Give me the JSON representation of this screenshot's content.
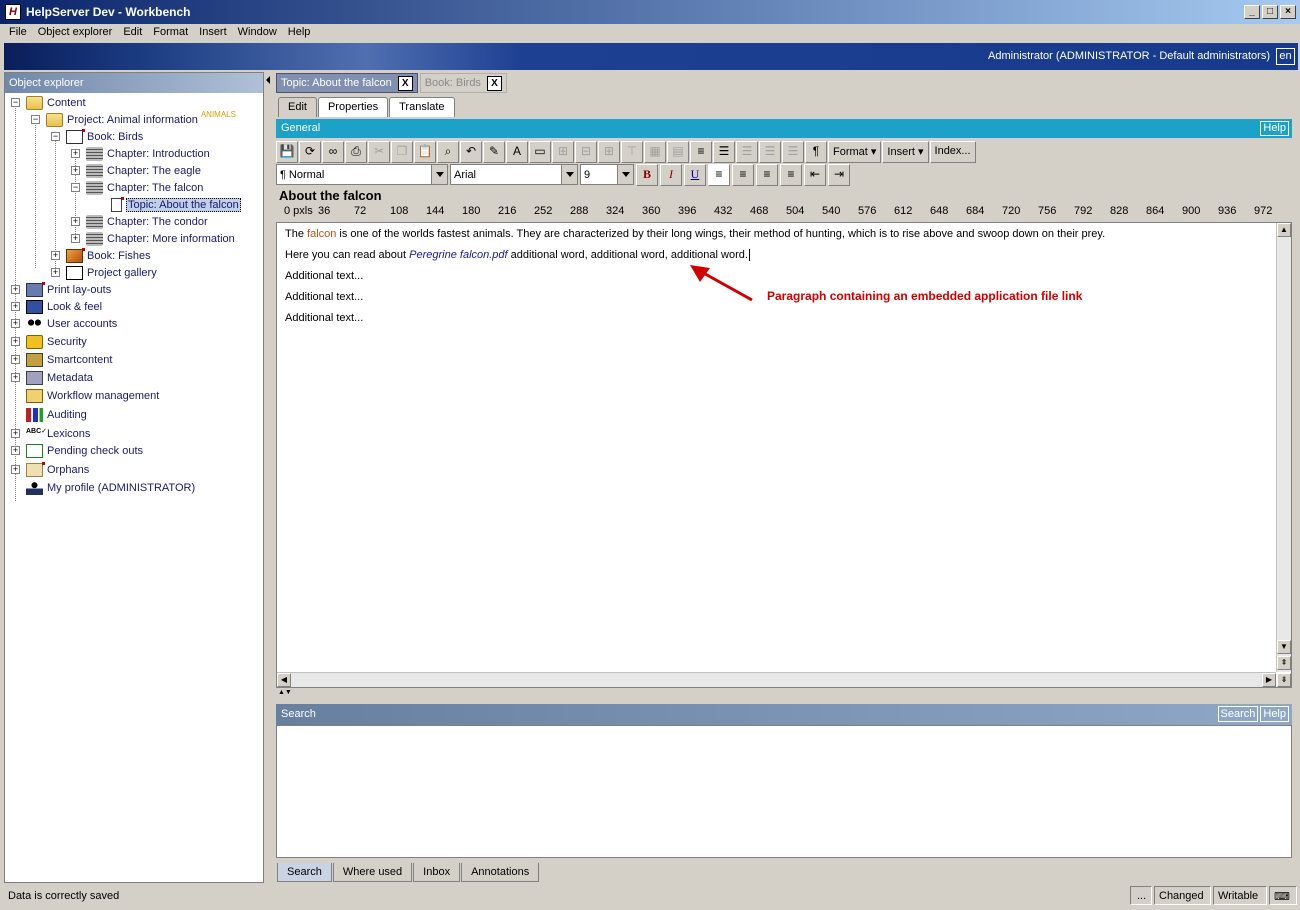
{
  "window": {
    "title": "HelpServer Dev - Workbench",
    "app_icon": "H"
  },
  "menu": [
    "File",
    "Object explorer",
    "Edit",
    "Format",
    "Insert",
    "Window",
    "Help"
  ],
  "banner": {
    "user": "Administrator (ADMINISTRATOR - Default administrators)",
    "lang": "en"
  },
  "explorer": {
    "header": "Object explorer",
    "items": [
      {
        "label": "Content",
        "icon": "folder-icon"
      },
      {
        "label": "Project: Animal information",
        "tag": "ANIMALS",
        "icon": "project-icon"
      },
      {
        "label": "Book: Birds",
        "icon": "book-icon"
      },
      {
        "label": "Chapter: Introduction",
        "icon": "chapter-icon"
      },
      {
        "label": "Chapter: The eagle",
        "icon": "chapter-icon"
      },
      {
        "label": "Chapter: The falcon",
        "icon": "chapter-icon"
      },
      {
        "label": "Topic: About the falcon",
        "icon": "topic-icon"
      },
      {
        "label": "Chapter: The condor",
        "icon": "chapter-icon"
      },
      {
        "label": "Chapter: More information",
        "icon": "chapter-icon"
      },
      {
        "label": "Book: Fishes",
        "icon": "book-icon"
      },
      {
        "label": "Project gallery",
        "icon": "gallery-icon"
      },
      {
        "label": "Print lay-outs",
        "icon": "printer-icon"
      },
      {
        "label": "Look & feel",
        "icon": "monitor-icon"
      },
      {
        "label": "User accounts",
        "icon": "users-icon"
      },
      {
        "label": "Security",
        "icon": "lock-icon"
      },
      {
        "label": "Smartcontent",
        "icon": "smartcontent-icon"
      },
      {
        "label": "Metadata",
        "icon": "metadata-icon"
      },
      {
        "label": "Workflow management",
        "icon": "workflow-icon"
      },
      {
        "label": "Auditing",
        "icon": "auditing-icon"
      },
      {
        "label": "Lexicons",
        "icon": "lexicon-icon"
      },
      {
        "label": "Pending check outs",
        "icon": "pending-icon"
      },
      {
        "label": "Orphans",
        "icon": "orphans-icon"
      },
      {
        "label": "My profile (ADMINISTRATOR)",
        "icon": "profile-icon"
      }
    ]
  },
  "doc_tabs": [
    {
      "label": "Topic: About the falcon",
      "close": "X"
    },
    {
      "label": "Book: Birds",
      "close": "X"
    }
  ],
  "mode_tabs": [
    "Edit",
    "Properties",
    "Translate"
  ],
  "general": {
    "label": "General",
    "help": "Help"
  },
  "toolbar": {
    "format_label": "Format",
    "insert_label": "Insert",
    "index_label": "Index...",
    "style_value": "Normal",
    "font_value": "Arial",
    "size_value": "9",
    "bold": "B",
    "italic": "I",
    "underline": "U"
  },
  "document": {
    "title": "About the falcon",
    "ruler_unit": "0 pxls",
    "ruler_ticks": [
      "36",
      "72",
      "108",
      "144",
      "180",
      "216",
      "252",
      "288",
      "324",
      "360",
      "396",
      "432",
      "468",
      "504",
      "540",
      "576",
      "612",
      "648",
      "684",
      "720",
      "756",
      "792",
      "828",
      "864",
      "900",
      "936",
      "972"
    ],
    "para1_pre": "The ",
    "para1_highlight": "falcon",
    "para1_post": " is one of the worlds fastest animals. They are characterized by their long wings, their method of hunting, which is to rise above and swoop down on their prey.",
    "para2_pre": "Here you can read about ",
    "para2_link": "Peregrine falcon.pdf",
    "para2_post": " additional word, additional word, additional word.",
    "para3": "Additional text...",
    "para4": "Additional text...",
    "para5": "Additional text..."
  },
  "annotation": "Paragraph containing an embedded application file link",
  "search": {
    "header": "Search",
    "search_btn": "Search",
    "help_btn": "Help"
  },
  "bottom_tabs": [
    "Search",
    "Where used",
    "Inbox",
    "Annotations"
  ],
  "status": {
    "message": "Data is correctly saved",
    "dots": "...",
    "changed": "Changed",
    "writable": "Writable"
  }
}
